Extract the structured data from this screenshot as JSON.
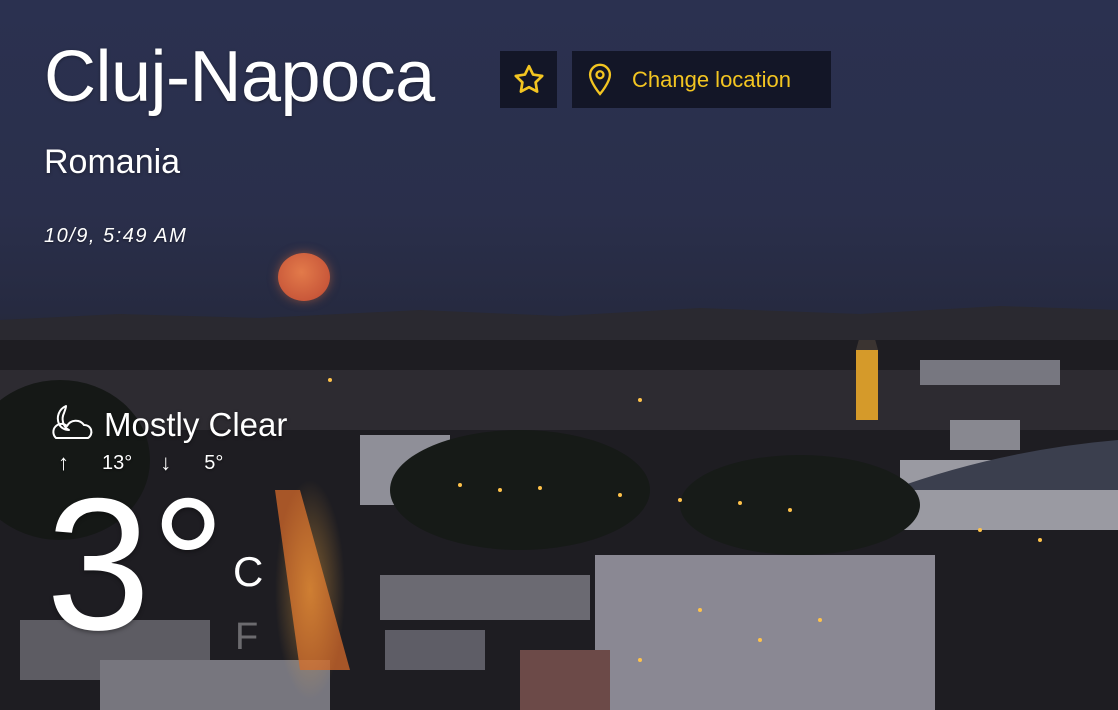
{
  "location": {
    "city": "Cluj-Napoca",
    "country": "Romania",
    "datetime": "10/9, 5:49 AM"
  },
  "actions": {
    "favorite_icon": "star-icon",
    "change_location_label": "Change location",
    "change_location_icon": "map-pin-icon"
  },
  "weather": {
    "condition": "Mostly Clear",
    "condition_icon": "moon-cloud-icon",
    "high": "13°",
    "low": "5°",
    "temperature": "3°",
    "unit_celsius": "C",
    "unit_fahrenheit": "F"
  },
  "colors": {
    "accent": "#f3c521",
    "button_bg": "#10121f",
    "text": "#ffffff"
  }
}
